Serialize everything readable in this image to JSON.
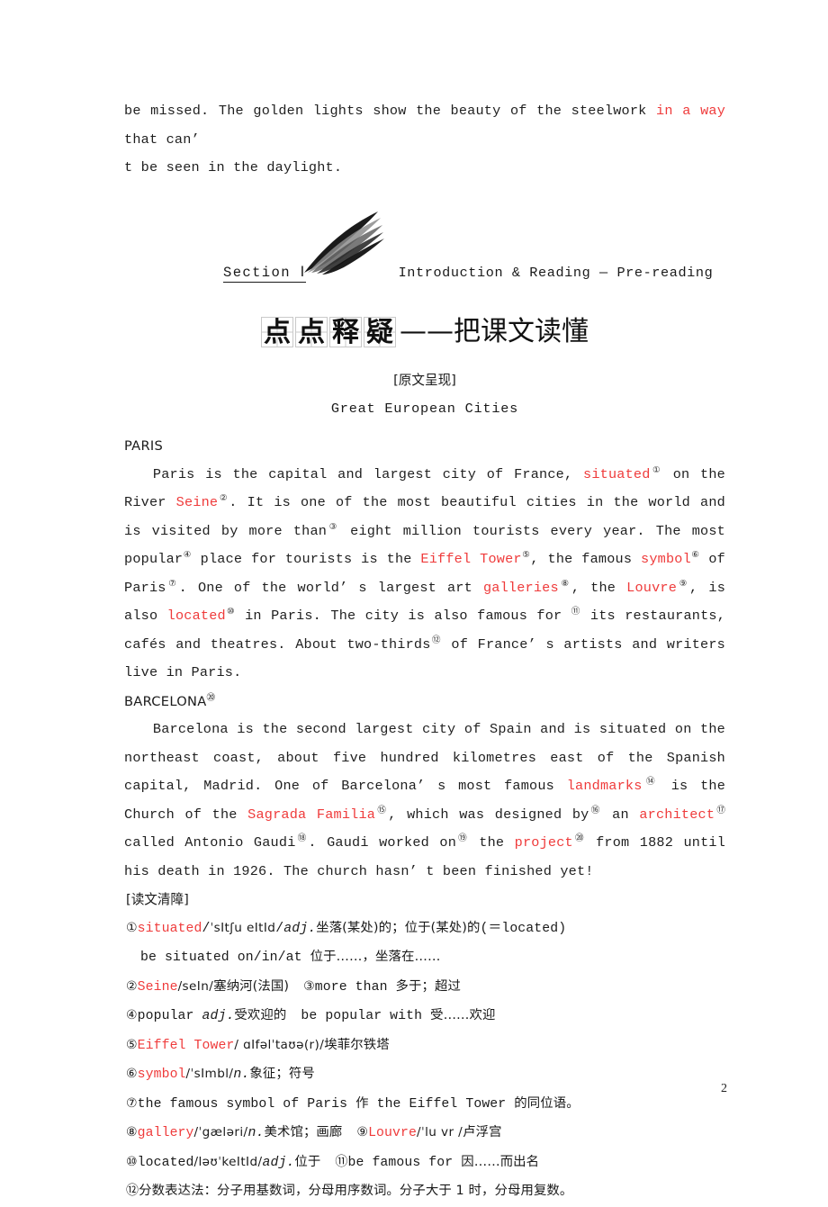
{
  "document": {
    "page_number": "2",
    "accent_color": "#ef3b3b",
    "text_color": "#1f1f1f"
  },
  "top_paragraph": {
    "line1_a": "be missed. The golden lights show the beauty of the steelwork ",
    "line1_red": "in a way",
    "line1_b": " that can’",
    "line2": "t be seen in the daylight."
  },
  "section_header": {
    "label": "Section Ⅰ",
    "subtitle": "Introduction & Reading — Pre-reading",
    "swoosh_icon": "brush-swoosh-icon",
    "cn_title_chars": [
      "点",
      "点",
      "释",
      "疑"
    ],
    "cn_title_tail": "——把课文读懂"
  },
  "passage": {
    "bracket_heading": "[原文呈现]",
    "article_title": "Great European Cities",
    "paris_heading": "PARIS",
    "barcelona_heading": "BARCELONA",
    "barcelona_heading_sup": "⑳",
    "paris_paragraph": [
      {
        "t": "Paris is the capital and largest city of France, "
      },
      {
        "t": "situated",
        "c": "red"
      },
      {
        "t": "①",
        "c": "sup"
      },
      {
        "t": " on the River "
      },
      {
        "t": "Seine",
        "c": "red"
      },
      {
        "t": "②",
        "c": "sup"
      },
      {
        "t": ". It is one of the most beautiful cities in the world and is visited by more than"
      },
      {
        "t": "③",
        "c": "sup"
      },
      {
        "t": " eight million tourists every year. The most popular"
      },
      {
        "t": "④",
        "c": "sup"
      },
      {
        "t": " place for tourists is the "
      },
      {
        "t": "Eiffel Tower",
        "c": "red"
      },
      {
        "t": "⑤",
        "c": "sup"
      },
      {
        "t": ", the famous "
      },
      {
        "t": "symbol",
        "c": "red"
      },
      {
        "t": "⑥",
        "c": "sup"
      },
      {
        "t": " of Paris"
      },
      {
        "t": "⑦",
        "c": "sup"
      },
      {
        "t": ". One of the world’ s largest art "
      },
      {
        "t": "galleries",
        "c": "red"
      },
      {
        "t": "⑧",
        "c": "sup"
      },
      {
        "t": ", the "
      },
      {
        "t": "Louvre",
        "c": "red"
      },
      {
        "t": "⑨",
        "c": "sup"
      },
      {
        "t": ", is also "
      },
      {
        "t": "located",
        "c": "red"
      },
      {
        "t": "⑩",
        "c": "sup"
      },
      {
        "t": " in Paris. The city is also famous for "
      },
      {
        "t": "⑪",
        "c": "sup"
      },
      {
        "t": " its restaurants, cafés and theatres. About two-thirds"
      },
      {
        "t": "⑫",
        "c": "sup"
      },
      {
        "t": " of France’ s artists and writers live in Paris."
      }
    ],
    "barcelona_paragraph": [
      {
        "t": "Barcelona is the second largest city of Spain and is situated on the northeast coast, about five hundred kilometres east of the Spanish capital, Madrid. One of Barcelona’ s most famous "
      },
      {
        "t": "landmarks",
        "c": "red"
      },
      {
        "t": "⑭",
        "c": "sup"
      },
      {
        "t": " is the Church of the "
      },
      {
        "t": "Sagrada Familia",
        "c": "red"
      },
      {
        "t": "⑮",
        "c": "sup"
      },
      {
        "t": ", which was designed by"
      },
      {
        "t": "⑯",
        "c": "sup"
      },
      {
        "t": " an "
      },
      {
        "t": "architect",
        "c": "red"
      },
      {
        "t": "⑰",
        "c": "sup"
      },
      {
        "t": " called Antonio Gaudi"
      },
      {
        "t": "⑱",
        "c": "sup"
      },
      {
        "t": ". Gaudi worked on"
      },
      {
        "t": "⑲",
        "c": "sup"
      },
      {
        "t": " the "
      },
      {
        "t": "project",
        "c": "red"
      },
      {
        "t": "⑳",
        "c": "sup"
      },
      {
        "t": " from 1882 until his death in 1926. The church hasn’ t been finished yet!"
      }
    ]
  },
  "notes": {
    "heading": "[读文清障]",
    "items": [
      {
        "id": "note-1",
        "parts": [
          {
            "t": "①",
            "c": "circ"
          },
          {
            "t": "situated",
            "c": "red"
          },
          {
            "t": "/",
            "c": ""
          },
          {
            "t": "ˈsItʃu  eItId",
            "c": "ipa"
          },
          {
            "t": "/",
            "c": ""
          },
          {
            "t": "adj.",
            "c": "ital"
          },
          {
            "t": "坐落(某处)的；位于(某处)的",
            "c": "cn"
          },
          {
            "t": "(＝located)",
            "c": ""
          }
        ]
      },
      {
        "id": "note-1b",
        "indent": true,
        "parts": [
          {
            "t": "be situated on/in/at ",
            "c": ""
          },
          {
            "t": "位于……，坐落在……",
            "c": "cn"
          }
        ]
      },
      {
        "id": "note-2",
        "parts": [
          {
            "t": "②",
            "c": "circ"
          },
          {
            "t": "Seine",
            "c": "red"
          },
          {
            "t": "/seIn/",
            "c": "ipa"
          },
          {
            "t": "塞纳河(法国)",
            "c": "cn"
          },
          {
            "t": "  ",
            "c": "gap"
          },
          {
            "t": "③",
            "c": "circ"
          },
          {
            "t": "more than ",
            "c": ""
          },
          {
            "t": "多于；超过",
            "c": "cn"
          }
        ]
      },
      {
        "id": "note-4",
        "parts": [
          {
            "t": "④",
            "c": "circ"
          },
          {
            "t": "popular ",
            "c": ""
          },
          {
            "t": "adj.",
            "c": "ital"
          },
          {
            "t": "受欢迎的",
            "c": "cn"
          },
          {
            "t": "  ",
            "c": "gap"
          },
          {
            "t": "be popular with ",
            "c": ""
          },
          {
            "t": "受……欢迎",
            "c": "cn"
          }
        ]
      },
      {
        "id": "note-5",
        "parts": [
          {
            "t": "⑤",
            "c": "circ"
          },
          {
            "t": "Eiffel Tower",
            "c": "red"
          },
          {
            "t": "/  ɑIfəlˈtaʊə(r)/",
            "c": "ipa"
          },
          {
            "t": "埃菲尔铁塔",
            "c": "cn"
          }
        ]
      },
      {
        "id": "note-6",
        "parts": [
          {
            "t": "⑥",
            "c": "circ"
          },
          {
            "t": "symbol",
            "c": "red"
          },
          {
            "t": "/ˈsImbl/",
            "c": "ipa"
          },
          {
            "t": "n.",
            "c": "ital"
          },
          {
            "t": "象征；符号",
            "c": "cn"
          }
        ]
      },
      {
        "id": "note-7",
        "parts": [
          {
            "t": "⑦",
            "c": "circ"
          },
          {
            "t": "the famous symbol of Paris ",
            "c": ""
          },
          {
            "t": "作",
            "c": "cn"
          },
          {
            "t": " the Eiffel Tower ",
            "c": ""
          },
          {
            "t": "的同位语。",
            "c": "cn"
          }
        ]
      },
      {
        "id": "note-8",
        "parts": [
          {
            "t": "⑧",
            "c": "circ"
          },
          {
            "t": "gallery",
            "c": "red"
          },
          {
            "t": "/ˈgæləri/",
            "c": "ipa"
          },
          {
            "t": "n.",
            "c": "ital"
          },
          {
            "t": "美术馆；画廊",
            "c": "cn"
          },
          {
            "t": "  ",
            "c": "gap"
          },
          {
            "t": "⑨",
            "c": "circ"
          },
          {
            "t": "Louvre",
            "c": "red"
          },
          {
            "t": "/ˈlu  vr /",
            "c": "ipa"
          },
          {
            "t": "卢浮宫",
            "c": "cn"
          }
        ]
      },
      {
        "id": "note-10",
        "parts": [
          {
            "t": "⑩",
            "c": "circ"
          },
          {
            "t": "located",
            "c": ""
          },
          {
            "t": "/ləʊˈkeItId/",
            "c": "ipa"
          },
          {
            "t": "adj.",
            "c": "ital"
          },
          {
            "t": "位于",
            "c": "cn"
          },
          {
            "t": "  ",
            "c": "gap"
          },
          {
            "t": "⑪",
            "c": "circ"
          },
          {
            "t": "be famous for ",
            "c": ""
          },
          {
            "t": "因……而出名",
            "c": "cn"
          }
        ]
      },
      {
        "id": "note-12",
        "parts": [
          {
            "t": "⑫",
            "c": "circ"
          },
          {
            "t": "分数表达法：分子用基数词，分母用序数词。分子大于 1 时，分母用复数。",
            "c": "cn"
          }
        ]
      }
    ]
  }
}
